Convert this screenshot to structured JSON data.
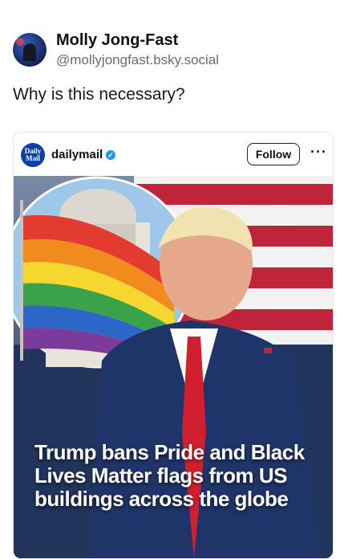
{
  "post": {
    "author_name": "Molly Jong-Fast",
    "author_handle": "@mollyjongfast.bsky.social",
    "text": "Why is this necessary?"
  },
  "embed": {
    "account_logo_text": "Daily Mail",
    "account_name": "dailymail",
    "follow_label": "Follow",
    "more_label": "···",
    "image_watermark": "m",
    "headline": "Trump bans Pride and Black Lives Matter flags from US buildings across the globe"
  },
  "colors": {
    "dailymail_blue": "#0a3fa8",
    "verified_blue": "#1d9bf0"
  }
}
